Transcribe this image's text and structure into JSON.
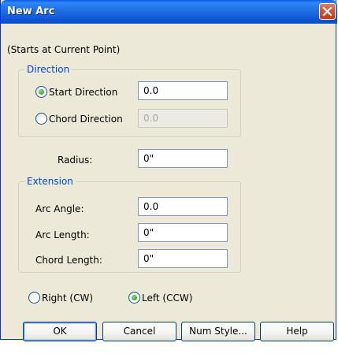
{
  "window": {
    "title": "New Arc"
  },
  "subtitle": "(Starts at Current Point)",
  "direction": {
    "legend": "Direction",
    "start_label": "Start Direction",
    "start_value": "0.0",
    "start_selected": true,
    "chord_label": "Chord Direction",
    "chord_value": "0.0",
    "chord_selected": false
  },
  "radius": {
    "label": "Radius:",
    "value": "0\""
  },
  "extension": {
    "legend": "Extension",
    "arc_angle_label": "Arc Angle:",
    "arc_angle_value": "0.0",
    "arc_length_label": "Arc Length:",
    "arc_length_value": "0\"",
    "chord_length_label": "Chord Length:",
    "chord_length_value": "0\""
  },
  "orientation": {
    "right_label": "Right (CW)",
    "right_selected": false,
    "left_label": "Left (CCW)",
    "left_selected": true
  },
  "buttons": {
    "ok": "OK",
    "cancel": "Cancel",
    "num_style": "Num Style...",
    "help": "Help"
  },
  "icons": {
    "close": "close-icon"
  },
  "colors": {
    "titlebar": "#0A5FE8",
    "group_title": "#0046D5",
    "radio_dot": "#21A121"
  }
}
